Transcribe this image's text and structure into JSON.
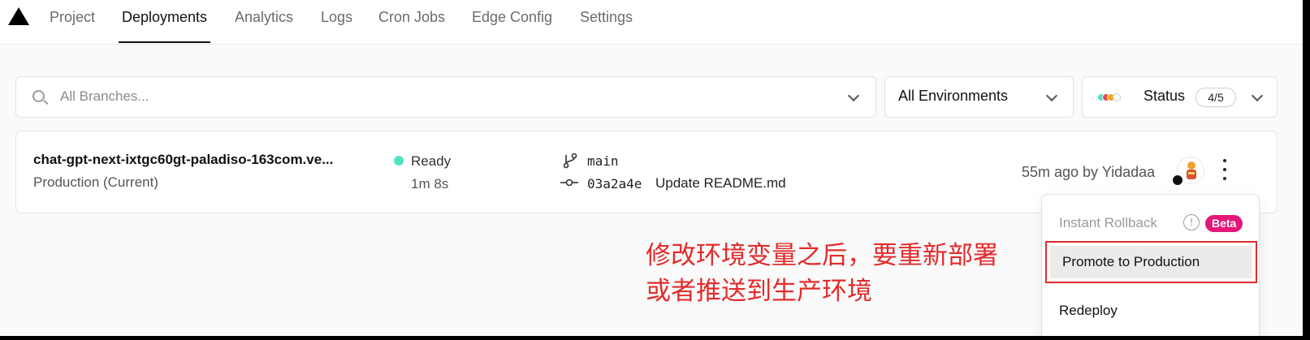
{
  "nav": {
    "tabs": [
      {
        "label": "Project",
        "active": false
      },
      {
        "label": "Deployments",
        "active": true
      },
      {
        "label": "Analytics",
        "active": false
      },
      {
        "label": "Logs",
        "active": false
      },
      {
        "label": "Cron Jobs",
        "active": false
      },
      {
        "label": "Edge Config",
        "active": false
      },
      {
        "label": "Settings",
        "active": false
      }
    ]
  },
  "filters": {
    "branch_placeholder": "All Branches...",
    "environment": "All Environments",
    "status_label": "Status",
    "status_count": "4/5",
    "status_colors": [
      "#50e3c2",
      "#e5484d",
      "#f5a623",
      "#cccccc"
    ]
  },
  "deployment": {
    "name": "chat-gpt-next-ixtgc60gt-paladiso-163com.ve...",
    "environment": "Production (Current)",
    "status": "Ready",
    "status_color": "#50e3c2",
    "duration": "1m 8s",
    "branch": "main",
    "commit_hash": "03a2a4e",
    "commit_message": "Update README.md",
    "time_by": "55m ago by Yidadaa"
  },
  "menu": {
    "rollback": "Instant Rollback",
    "beta": "Beta",
    "promote": "Promote to Production",
    "redeploy": "Redeploy"
  },
  "annotation": {
    "line1": "修改环境变量之后，要重新部署",
    "line2": "或者推送到生产环境",
    "color": "#e32b2b"
  }
}
